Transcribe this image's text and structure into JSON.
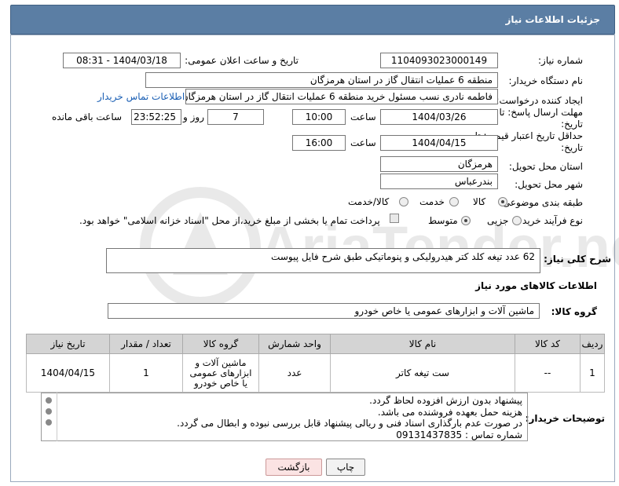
{
  "title": "جزئیات اطلاعات نیاز",
  "fields": {
    "need_number_label": "شماره نیاز:",
    "need_number": "1104093023000149",
    "announce_label": "تاریخ و ساعت اعلان عمومی:",
    "announce_value": "1404/03/18 - 08:31",
    "buyer_label": "نام دستگاه خریدار:",
    "buyer_value": "منطقه 6 عملیات انتقال گاز در استان هرمزگان",
    "creator_label": "ایجاد کننده درخواست:",
    "creator_value": "فاطمه نادری نسب مسئول خرید منطقه 6 عملیات انتقال گاز در استان هرمزگان",
    "contact_link": "اطلاعات تماس خریدار",
    "deadline_label": "مهلت ارسال پاسخ: تا تاریخ:",
    "deadline_date": "1404/03/26",
    "time_label": "ساعت",
    "deadline_time": "10:00",
    "days_value": "7",
    "days_label": "روز و",
    "remaining_value": "23:52:25",
    "remaining_label": "ساعت باقی مانده",
    "validity_label": "حداقل تاریخ اعتبار قیمت: تا تاریخ:",
    "validity_date": "1404/04/15",
    "validity_time": "16:00",
    "province_label": "استان محل تحویل:",
    "province_value": "هرمزگان",
    "city_label": "شهر محل تحویل:",
    "city_value": "بندرعباس",
    "category_label": "طبقه بندی موضوعی:",
    "category_options": [
      "کالا",
      "خدمت",
      "کالا/خدمت"
    ],
    "category_selected": "کالا",
    "process_label": "نوع فرآیند خرید :",
    "process_options": [
      "جزیی",
      "متوسط"
    ],
    "process_selected": "متوسط",
    "payment_note": "پرداخت تمام یا بخشی از مبلغ خرید،از محل \"اسناد خزانه اسلامی\" خواهد بود.",
    "summary_label": "شرح کلی نیاز:",
    "summary_value": "62 عدد تیغه کلد کتر هیدرولیکی و پنوماتیکی طبق شرح فایل پیوست",
    "goods_info_title": "اطلاعات کالاهای مورد نیاز",
    "goods_group_label": "گروه کالا:",
    "goods_group_value": "ماشین آلات و ابزارهای عمومی یا خاص خودرو",
    "buyer_notes_label": "توضیحات خریدار:",
    "buyer_notes": [
      "پیشنهاد بدون ارزش افزوده لحاظ گردد.",
      "هزینه حمل بعهده فروشنده می باشد.",
      "در صورت عدم بارگذاری اسناد فنی و ریالی پیشنهاد قابل بررسی نبوده و ابطال می گردد.",
      "شماره تماس : 09131437835"
    ]
  },
  "table": {
    "headers": [
      "ردیف",
      "کد کالا",
      "نام کالا",
      "واحد شمارش",
      "گروه کالا",
      "تعداد / مقدار",
      "تاریخ نیاز"
    ],
    "rows": [
      [
        "1",
        "--",
        "ست تیغه کاتر",
        "عدد",
        "ماشین آلات و ابزارهای عمومی یا خاص خودرو",
        "1",
        "1404/04/15"
      ]
    ]
  },
  "buttons": {
    "print": "چاپ",
    "back": "بازگشت"
  },
  "watermark_text": "AriaTender.neT",
  "colors": {
    "title_bg": "#5b7ea4",
    "link": "#1a5fb4",
    "back_bg": "#fbe3e3",
    "print_bg": "#f2f2f2"
  }
}
